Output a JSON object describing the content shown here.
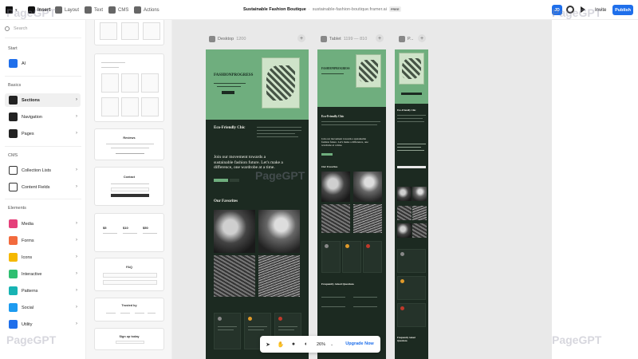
{
  "topbar": {
    "nav": [
      {
        "label": "Insert",
        "icon": "insert-icon",
        "active": true
      },
      {
        "label": "Layout",
        "icon": "layout-icon",
        "active": false
      },
      {
        "label": "Text",
        "icon": "text-icon",
        "active": false
      },
      {
        "label": "CMS",
        "icon": "cms-icon",
        "active": false
      },
      {
        "label": "Actions",
        "icon": "actions-icon",
        "active": false
      }
    ],
    "project_name": "Sustainable Fashion Boutique",
    "separator": "·",
    "site_url": "sustainable-fashion-boutique.framer.ai",
    "plan_badge": "FREE",
    "avatar_initials": "JD",
    "invite_label": "Invite",
    "publish_label": "Publish"
  },
  "sidebar": {
    "search_placeholder": "Search",
    "sections": {
      "start": "Start",
      "basics": "Basics",
      "cms": "CMS",
      "elements": "Elements"
    },
    "start_items": [
      {
        "label": "AI",
        "icon": "ai-icon",
        "color": "#1f6feb"
      }
    ],
    "basics_items": [
      {
        "label": "Sections",
        "icon": "sections-icon",
        "color": "#222222",
        "active": true
      },
      {
        "label": "Navigation",
        "icon": "navigation-icon",
        "color": "#222222"
      },
      {
        "label": "Pages",
        "icon": "pages-icon",
        "color": "#222222"
      }
    ],
    "cms_items": [
      {
        "label": "Collection Lists",
        "icon": "collection-list-icon",
        "color": "#ffffff"
      },
      {
        "label": "Content Fields",
        "icon": "content-fields-icon",
        "color": "#ffffff"
      }
    ],
    "element_items": [
      {
        "label": "Media",
        "icon": "media-icon",
        "color": "#e5407a"
      },
      {
        "label": "Forms",
        "icon": "forms-icon",
        "color": "#f26a3d"
      },
      {
        "label": "Icons",
        "icon": "icons-icon",
        "color": "#f5b800"
      },
      {
        "label": "Interactive",
        "icon": "interactive-icon",
        "color": "#2fbf71"
      },
      {
        "label": "Patterns",
        "icon": "patterns-icon",
        "color": "#17b3b3"
      },
      {
        "label": "Social",
        "icon": "social-icon",
        "color": "#1d9bf0"
      },
      {
        "label": "Utility",
        "icon": "utility-icon",
        "color": "#1f6feb"
      }
    ]
  },
  "thumbnails": {
    "reviews": "Reviews",
    "contact": "Contact",
    "prices": [
      "$5",
      "$10",
      "$50"
    ],
    "faq": "FAQ",
    "trusted": "Trusted by",
    "signup": "Sign up today"
  },
  "canvas": {
    "breakpoints": [
      {
        "name": "Desktop",
        "range": "1200"
      },
      {
        "name": "Tablet",
        "range": "1199 — 810"
      },
      {
        "name": "P...",
        "range": ""
      }
    ],
    "site": {
      "brand": "FASHIONPROGRESS",
      "tagline": "Eco-Friendly Chic",
      "mission": "Join our movement towards a sustainable fashion future. Let's make a difference, one wardrobe at a time.",
      "favorites_heading": "Our Favorites",
      "faq_heading": "Frequently Asked Questions"
    },
    "colors": {
      "hero": "#6fae7e",
      "dark": "#1c2a21"
    }
  },
  "toolbar": {
    "zoom": "26%",
    "upgrade_label": "Upgrade Now"
  },
  "watermark": "PageGPT"
}
